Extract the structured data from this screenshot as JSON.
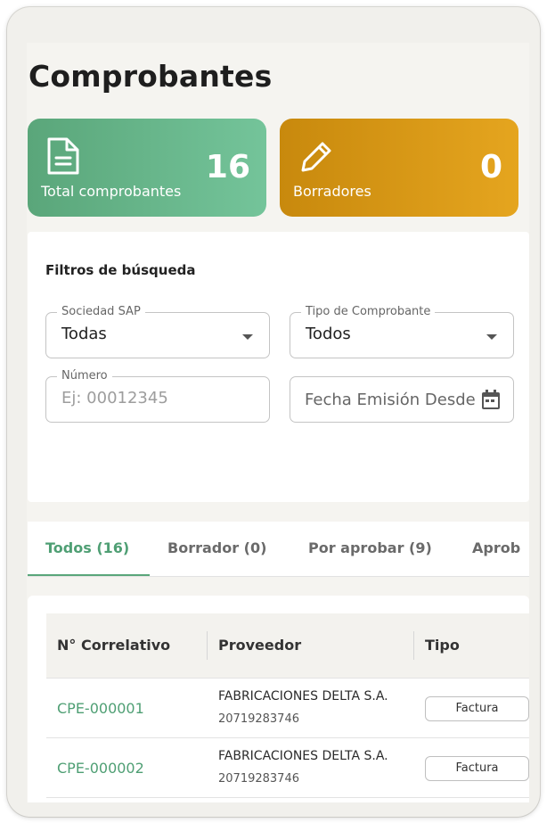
{
  "page": {
    "title": "Comprobantes"
  },
  "stats": {
    "total": {
      "label": "Total comprobantes",
      "value": "16",
      "icon": "document-icon",
      "color": "#5aa67a"
    },
    "drafts": {
      "label": "Borradores",
      "value": "0",
      "icon": "pencil-icon",
      "color": "#d9991a"
    }
  },
  "filters": {
    "title": "Filtros de búsqueda",
    "sociedad": {
      "label": "Sociedad SAP",
      "value": "Todas"
    },
    "tipo": {
      "label": "Tipo de Comprobante",
      "value": "Todos"
    },
    "numero": {
      "label": "Número",
      "placeholder": "Ej: 00012345"
    },
    "fecha": {
      "value": "Fecha Emisión Desde",
      "icon": "calendar-icon"
    }
  },
  "tabs": [
    {
      "label": "Todos (16)",
      "active": true
    },
    {
      "label": "Borrador (0)"
    },
    {
      "label": "Por aprobar (9)"
    },
    {
      "label": "Aprob"
    }
  ],
  "table": {
    "columns": [
      "N° Correlativo",
      "Proveedor",
      "Tipo"
    ],
    "rows": [
      {
        "correlativo": "CPE-000001",
        "proveedor": "FABRICACIONES DELTA S.A.",
        "ruc": "20719283746",
        "tipo": "Factura"
      },
      {
        "correlativo": "CPE-000002",
        "proveedor": "FABRICACIONES DELTA S.A.",
        "ruc": "20719283746",
        "tipo": "Factura"
      }
    ]
  },
  "colors": {
    "accent": "#4f9f74",
    "warning": "#d9991a",
    "background": "#f5f4f0"
  }
}
